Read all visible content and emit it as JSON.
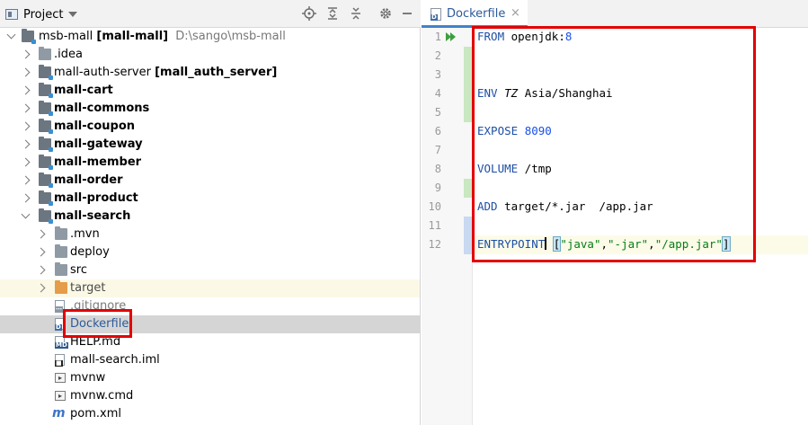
{
  "project_panel": {
    "title": "Project",
    "root": {
      "name": "msb-mall",
      "module": "[mall-mall]",
      "path": "D:\\sango\\msb-mall"
    },
    "items": [
      {
        "label": ".idea",
        "bold": false
      },
      {
        "label": "mall-auth-server",
        "suffix": "[mall_auth_server]",
        "bold": false
      },
      {
        "label": "mall-cart",
        "bold": true
      },
      {
        "label": "mall-commons",
        "bold": true
      },
      {
        "label": "mall-coupon",
        "bold": true
      },
      {
        "label": "mall-gateway",
        "bold": true
      },
      {
        "label": "mall-member",
        "bold": true
      },
      {
        "label": "mall-order",
        "bold": true
      },
      {
        "label": "mall-product",
        "bold": true
      },
      {
        "label": "mall-search",
        "bold": true
      }
    ],
    "children": [
      {
        "label": ".mvn"
      },
      {
        "label": "deploy"
      },
      {
        "label": "src"
      },
      {
        "label": "target"
      },
      {
        "label": ".gitignore"
      },
      {
        "label": "Dockerfile"
      },
      {
        "label": "HELP.md"
      },
      {
        "label": "mall-search.iml"
      },
      {
        "label": "mvnw"
      },
      {
        "label": "mvnw.cmd"
      },
      {
        "label": "pom.xml"
      }
    ]
  },
  "editor": {
    "tab_label": "Dockerfile",
    "lines": [
      {
        "n": "1",
        "kw": "FROM",
        "rest": " openjdk:",
        "num": "8"
      },
      {
        "n": "2"
      },
      {
        "n": "3"
      },
      {
        "n": "4",
        "kw": "ENV",
        "it": "TZ",
        "rest": " Asia/Shanghai"
      },
      {
        "n": "5"
      },
      {
        "n": "6",
        "kw": "EXPOSE",
        "num": "8090"
      },
      {
        "n": "7"
      },
      {
        "n": "8",
        "kw": "VOLUME",
        "rest": " /tmp"
      },
      {
        "n": "9"
      },
      {
        "n": "10",
        "kw": "ADD",
        "rest": " target/*.jar  /app.jar"
      },
      {
        "n": "11"
      },
      {
        "n": "12",
        "kw": "ENTRYPOINT",
        "s1": "\"java\"",
        "s2": "\"-jar\"",
        "s3": "\"/app.jar\""
      }
    ]
  },
  "colors": {
    "keyword": "#1d4fa5",
    "string": "#067d17",
    "number": "#1750eb",
    "highlight_box": "#e30000",
    "selection_row": "#d5d5d5"
  }
}
